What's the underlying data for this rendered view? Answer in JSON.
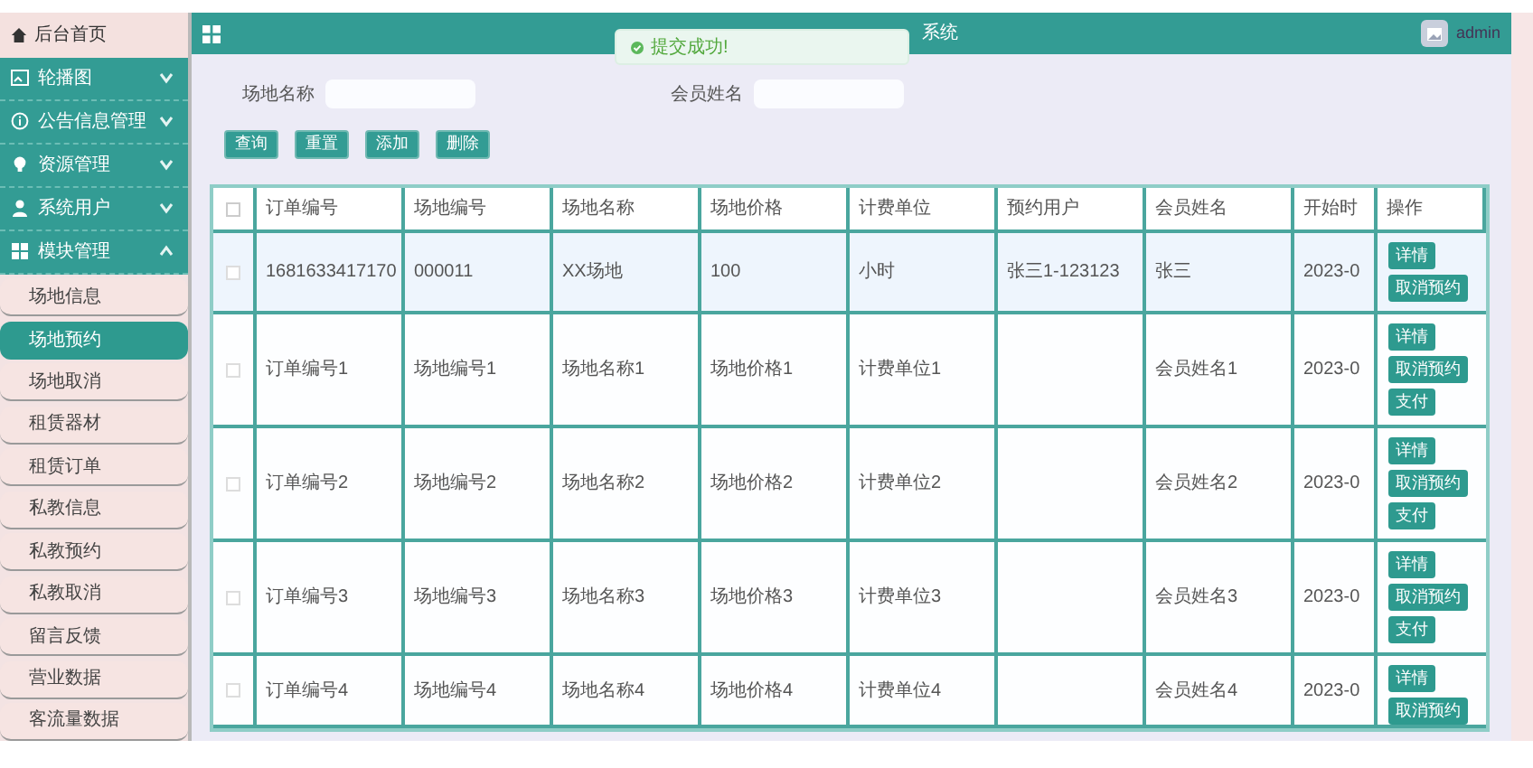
{
  "header": {
    "title": "系统",
    "user": "admin"
  },
  "toast": {
    "message": "提交成功!"
  },
  "sidebar": {
    "items": [
      {
        "label": "后台首页",
        "kind": "home"
      },
      {
        "label": "轮播图",
        "kind": "group",
        "expanded": false
      },
      {
        "label": "公告信息管理",
        "kind": "group",
        "expanded": false
      },
      {
        "label": "资源管理",
        "kind": "group",
        "expanded": false
      },
      {
        "label": "系统用户",
        "kind": "group",
        "expanded": false
      },
      {
        "label": "模块管理",
        "kind": "group",
        "expanded": true,
        "children": [
          {
            "label": "场地信息",
            "selected": false
          },
          {
            "label": "场地预约",
            "selected": true
          },
          {
            "label": "场地取消",
            "selected": false
          },
          {
            "label": "租赁器材",
            "selected": false
          },
          {
            "label": "租赁订单",
            "selected": false
          },
          {
            "label": "私教信息",
            "selected": false
          },
          {
            "label": "私教预约",
            "selected": false
          },
          {
            "label": "私教取消",
            "selected": false
          },
          {
            "label": "留言反馈",
            "selected": false
          },
          {
            "label": "营业数据",
            "selected": false
          },
          {
            "label": "客流量数据",
            "selected": false
          }
        ]
      }
    ]
  },
  "search": {
    "fields": [
      {
        "label": "场地名称"
      },
      {
        "label": "会员姓名"
      }
    ],
    "buttons": [
      "查询",
      "重置",
      "添加",
      "删除"
    ]
  },
  "table": {
    "all_checked": false,
    "columns": [
      "订单编号",
      "场地编号",
      "场地名称",
      "场地价格",
      "计费单位",
      "预约用户",
      "会员姓名",
      "开始时",
      "操作"
    ],
    "rows": [
      {
        "highlighted": true,
        "checked": false,
        "cells": [
          "1681633417170",
          "000011",
          "XX场地",
          "100",
          "小时",
          "张三1-123123",
          "张三",
          "2023-0"
        ],
        "actions": [
          "详情",
          "取消预约"
        ]
      },
      {
        "highlighted": false,
        "checked": false,
        "cells": [
          "订单编号1",
          "场地编号1",
          "场地名称1",
          "场地价格1",
          "计费单位1",
          "",
          "会员姓名1",
          "2023-0"
        ],
        "actions": [
          "详情",
          "取消预约",
          "支付"
        ]
      },
      {
        "highlighted": false,
        "checked": false,
        "cells": [
          "订单编号2",
          "场地编号2",
          "场地名称2",
          "场地价格2",
          "计费单位2",
          "",
          "会员姓名2",
          "2023-0"
        ],
        "actions": [
          "详情",
          "取消预约",
          "支付"
        ]
      },
      {
        "highlighted": false,
        "checked": false,
        "cells": [
          "订单编号3",
          "场地编号3",
          "场地名称3",
          "场地价格3",
          "计费单位3",
          "",
          "会员姓名3",
          "2023-0"
        ],
        "actions": [
          "详情",
          "取消预约",
          "支付"
        ]
      },
      {
        "highlighted": false,
        "checked": false,
        "cells": [
          "订单编号4",
          "场地编号4",
          "场地名称4",
          "场地价格4",
          "计费单位4",
          "",
          "会员姓名4",
          "2023-0"
        ],
        "actions": [
          "详情",
          "取消预约"
        ]
      }
    ]
  }
}
